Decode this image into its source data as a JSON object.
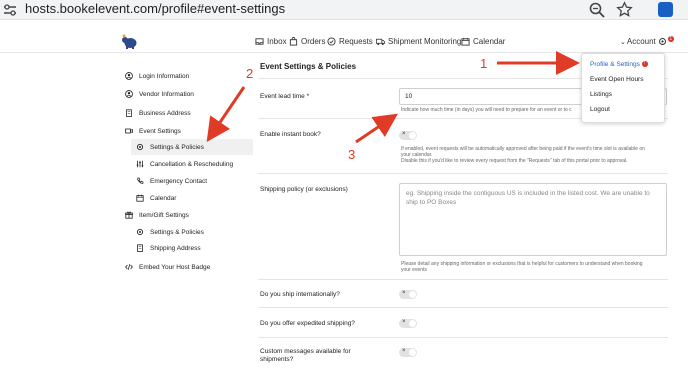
{
  "browser": {
    "url": "hosts.bookelevent.com/profile#event-settings",
    "icons": [
      "tune-icon",
      "zoom-icon",
      "star-icon",
      "extension-icon"
    ]
  },
  "header": {
    "nav": [
      {
        "label": "Inbox",
        "icon": "inbox-icon"
      },
      {
        "label": "Orders",
        "icon": "bag-icon"
      },
      {
        "label": "Requests",
        "icon": "requests-icon"
      },
      {
        "label": "Shipment Monitoring",
        "icon": "truck-icon"
      },
      {
        "label": "Calendar",
        "icon": "calendar-icon"
      }
    ],
    "account_label": "Account",
    "account_badge": "1"
  },
  "account_menu": {
    "items": [
      {
        "label": "Profile & Settings",
        "badge": "!"
      },
      {
        "label": "Event Open Hours"
      },
      {
        "label": "Listings"
      },
      {
        "label": "Logout"
      }
    ]
  },
  "sidebar": {
    "items": [
      {
        "label": "Login Information",
        "icon": "user-circle-icon"
      },
      {
        "label": "Vendor Information",
        "icon": "user-circle-icon"
      },
      {
        "label": "Business Address",
        "icon": "building-icon"
      },
      {
        "label": "Event Settings",
        "icon": "video-icon"
      },
      {
        "label": "Settings & Policies",
        "icon": "gear-icon"
      },
      {
        "label": "Cancellation & Rescheduling",
        "icon": "sliders-icon"
      },
      {
        "label": "Emergency Contact",
        "icon": "phone-icon"
      },
      {
        "label": "Calendar",
        "icon": "calendar-icon"
      },
      {
        "label": "Item/Gift Settings",
        "icon": "gift-icon"
      },
      {
        "label": "Settings & Policies",
        "icon": "gear-icon"
      },
      {
        "label": "Shipping Address",
        "icon": "building-icon"
      },
      {
        "label": "Embed Your Host Badge",
        "icon": "code-icon"
      }
    ]
  },
  "main": {
    "title": "Event Settings & Policies",
    "lead_time": {
      "label": "Event lead time *",
      "value": "10",
      "helper": "Indicate how much time (in days) you will need to prepare for an event or to c"
    },
    "instant_book": {
      "label": "Enable instant book?",
      "helper_line1": "If enabled, event requests will be automatically approved after being paid if the event's time slot is available on",
      "helper_line2": "your calendar.",
      "helper_line3": "Disable this if you'd like to review every request from the \"Requests\" tab of this portal prior to approval."
    },
    "shipping_policy": {
      "label": "Shipping policy (or exclusions)",
      "placeholder": "eg. Shipping inside the contiguous US is included in the listed cost. We are unable to ship to PO Boxes",
      "helper_line1": "Please detail any shipping information or exclusions that is helpful for customers to understand when booking",
      "helper_line2": "your events"
    },
    "ship_international": {
      "label": "Do you ship internationally?"
    },
    "expedited_shipping": {
      "label": "Do you offer expedited shipping?"
    },
    "custom_messages": {
      "label_line1": "Custom messages available for",
      "label_line2": "shipments?"
    },
    "toggle_symbol": "×"
  },
  "annotations": {
    "numbers": [
      "1",
      "2",
      "3"
    ],
    "color": "#e03b26"
  },
  "colors": {
    "accent": "#2a62c9",
    "badge": "#d93025",
    "annotation": "#e03b26"
  }
}
